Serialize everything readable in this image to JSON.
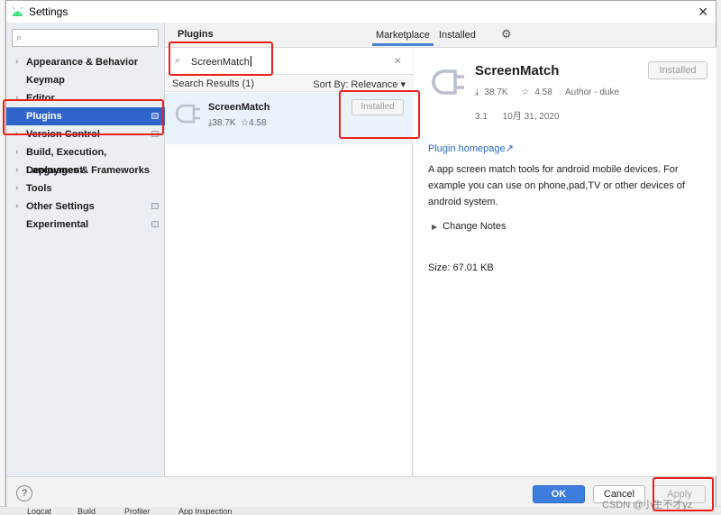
{
  "window": {
    "title": "Settings",
    "close_glyph": "✕"
  },
  "sidebar": {
    "search_placeholder": "",
    "items": [
      {
        "label": "Appearance & Behavior"
      },
      {
        "label": "Keymap"
      },
      {
        "label": "Editor"
      },
      {
        "label": "Plugins"
      },
      {
        "label": "Version Control"
      },
      {
        "label": "Build, Execution, Deployment"
      },
      {
        "label": "Languages & Frameworks"
      },
      {
        "label": "Tools"
      },
      {
        "label": "Other Settings"
      },
      {
        "label": "Experimental"
      }
    ]
  },
  "plugins_panel": {
    "header": "Plugins",
    "search_value": "ScreenMatch",
    "results_label": "Search Results (1)",
    "sort_label": "Sort By: Relevance",
    "result": {
      "name": "ScreenMatch",
      "downloads": "38.7K",
      "rating": "4.58",
      "button": "Installed"
    }
  },
  "tabs": {
    "marketplace": "Marketplace",
    "installed": "Installed"
  },
  "detail": {
    "name": "ScreenMatch",
    "button": "Installed",
    "downloads": "38.7K",
    "rating": "4.58",
    "author": "Author - duke",
    "version": "3.1",
    "date": "10月 31, 2020",
    "homepage": "Plugin homepage",
    "description": "A app screen match tools for android mobile devices. For example you can use on phone,pad,TV or other devices of android system.",
    "change_notes": "Change Notes",
    "size": "Size: 67.01 KB"
  },
  "footer": {
    "help": "?",
    "ok": "OK",
    "cancel": "Cancel",
    "apply": "Apply"
  },
  "background": {
    "bottom_tabs": [
      "Logcat",
      "Build",
      "Profiler",
      "App Inspection"
    ]
  },
  "watermark": "CSDN @小生不才yz",
  "colors": {
    "selection": "#2f65ca",
    "ok_button": "#3d7ddc",
    "link": "#2c68c8",
    "highlight": "#e8221b"
  },
  "icons": [
    "android-icon",
    "search-icon",
    "close-icon",
    "plugin-icon",
    "gear-icon",
    "download-icon",
    "star-icon",
    "help-icon"
  ]
}
